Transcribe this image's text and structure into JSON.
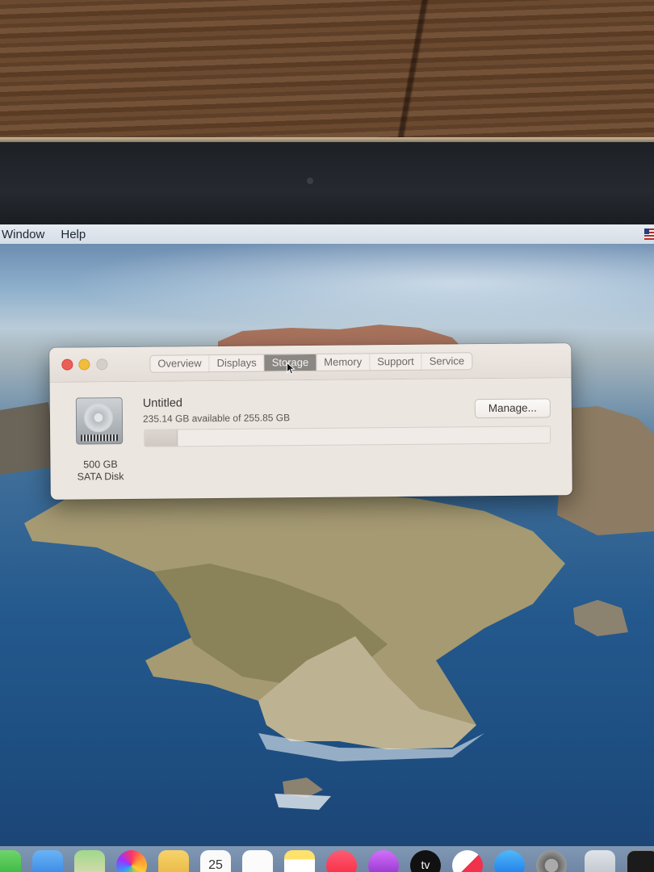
{
  "menubar": {
    "items": [
      "Window",
      "Help"
    ]
  },
  "about_window": {
    "tabs": [
      {
        "label": "Overview",
        "active": false
      },
      {
        "label": "Displays",
        "active": false
      },
      {
        "label": "Storage",
        "active": true
      },
      {
        "label": "Memory",
        "active": false
      },
      {
        "label": "Support",
        "active": false
      },
      {
        "label": "Service",
        "active": false
      }
    ],
    "disk": {
      "size": "500 GB",
      "type": "SATA Disk"
    },
    "volume": {
      "name": "Untitled",
      "available_text": "235.14 GB available of 255.85 GB",
      "used_fraction": 0.08
    },
    "manage_label": "Manage..."
  },
  "dock": {
    "icons": [
      "messages-icon",
      "mail-icon",
      "maps-icon",
      "photos-icon",
      "notes-folder-icon",
      "calendar-icon",
      "reminders-icon",
      "notes-icon",
      "music-icon",
      "podcasts-icon",
      "tv-icon",
      "news-icon",
      "app-store-icon",
      "system-preferences-icon",
      "disk-utility-icon",
      "terminal-icon"
    ],
    "calendar_day": "25",
    "tv_label": "tv"
  }
}
